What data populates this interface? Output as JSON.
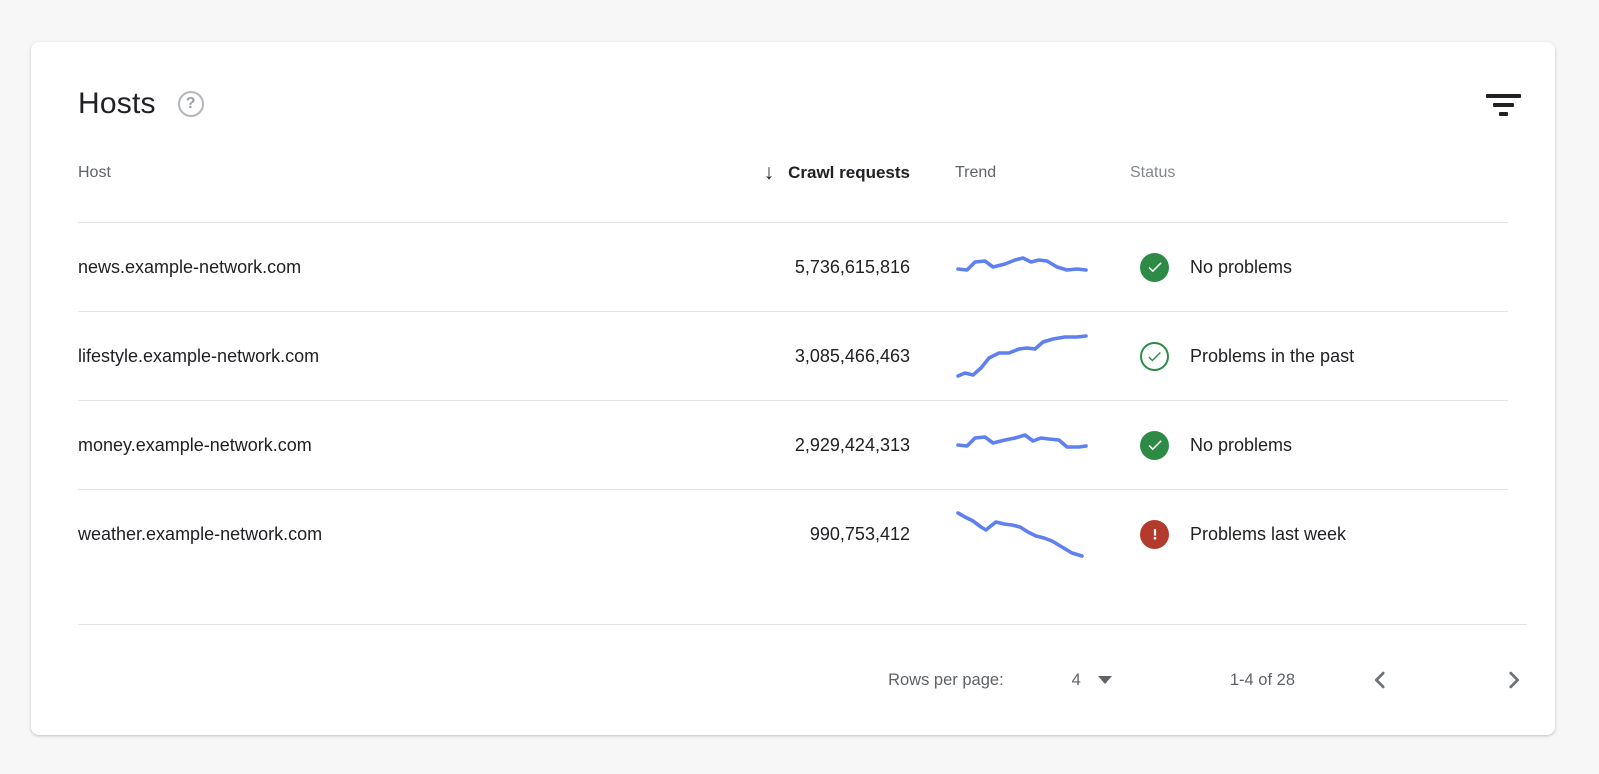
{
  "card": {
    "title": "Hosts",
    "help_glyph": "?",
    "help_icon": "help-question-circle",
    "filter_icon": "filter-list"
  },
  "table": {
    "columns": {
      "host": "Host",
      "crawl_requests": "Crawl requests",
      "trend": "Trend",
      "status": "Status"
    },
    "sort": {
      "column": "Crawl requests",
      "direction": "descending",
      "arrow": "↓"
    },
    "rows": [
      {
        "host": "news.example-network.com",
        "crawl_requests": "5,736,615,816",
        "status": "No problems",
        "status_icon": "check-circle-filled-green",
        "trend_points": [
          [
            3,
            26
          ],
          [
            12,
            27
          ],
          [
            20,
            19
          ],
          [
            30,
            18
          ],
          [
            38,
            24
          ],
          [
            50,
            21
          ],
          [
            60,
            17
          ],
          [
            68,
            15
          ],
          [
            76,
            19
          ],
          [
            84,
            17
          ],
          [
            92,
            18
          ],
          [
            102,
            24
          ],
          [
            112,
            27
          ],
          [
            122,
            26
          ],
          [
            131,
            27
          ]
        ]
      },
      {
        "host": "lifestyle.example-network.com",
        "crawl_requests": "3,085,466,463",
        "status": "Problems in the past",
        "status_icon": "check-circle-outline-green",
        "trend_points": [
          [
            3,
            44
          ],
          [
            10,
            41
          ],
          [
            18,
            43
          ],
          [
            26,
            36
          ],
          [
            34,
            26
          ],
          [
            44,
            21
          ],
          [
            54,
            21
          ],
          [
            64,
            17
          ],
          [
            72,
            16
          ],
          [
            80,
            17
          ],
          [
            88,
            10
          ],
          [
            98,
            7
          ],
          [
            110,
            5
          ],
          [
            122,
            5
          ],
          [
            131,
            4
          ]
        ]
      },
      {
        "host": "money.example-network.com",
        "crawl_requests": "2,929,424,313",
        "status": "No problems",
        "status_icon": "check-circle-filled-green",
        "trend_points": [
          [
            3,
            24
          ],
          [
            12,
            25
          ],
          [
            20,
            17
          ],
          [
            30,
            16
          ],
          [
            38,
            22
          ],
          [
            50,
            19
          ],
          [
            60,
            17
          ],
          [
            70,
            14
          ],
          [
            78,
            20
          ],
          [
            86,
            17
          ],
          [
            94,
            18
          ],
          [
            104,
            19
          ],
          [
            112,
            26
          ],
          [
            124,
            26
          ],
          [
            131,
            25
          ]
        ]
      },
      {
        "host": "weather.example-network.com",
        "crawl_requests": "990,753,412",
        "status": "Problems last week",
        "status_icon": "error-circle-filled-red",
        "trend_points": [
          [
            3,
            3
          ],
          [
            10,
            7
          ],
          [
            18,
            11
          ],
          [
            26,
            17
          ],
          [
            31,
            20
          ],
          [
            37,
            15
          ],
          [
            41,
            12
          ],
          [
            49,
            14
          ],
          [
            57,
            15
          ],
          [
            65,
            17
          ],
          [
            73,
            22
          ],
          [
            81,
            26
          ],
          [
            89,
            28
          ],
          [
            97,
            31
          ],
          [
            107,
            37
          ],
          [
            117,
            43
          ],
          [
            127,
            46
          ]
        ]
      }
    ]
  },
  "pagination": {
    "rows_per_page_label": "Rows per page:",
    "rows_per_page_value": "4",
    "range_label": "1-4 of 28",
    "prev_icon": "chevron-left",
    "next_icon": "chevron-right"
  },
  "colors": {
    "sparkline": "#5e80f0",
    "green": "#2e8b46",
    "red": "#b23b2c",
    "header_text": "#5f6368",
    "body_text": "#202124"
  }
}
